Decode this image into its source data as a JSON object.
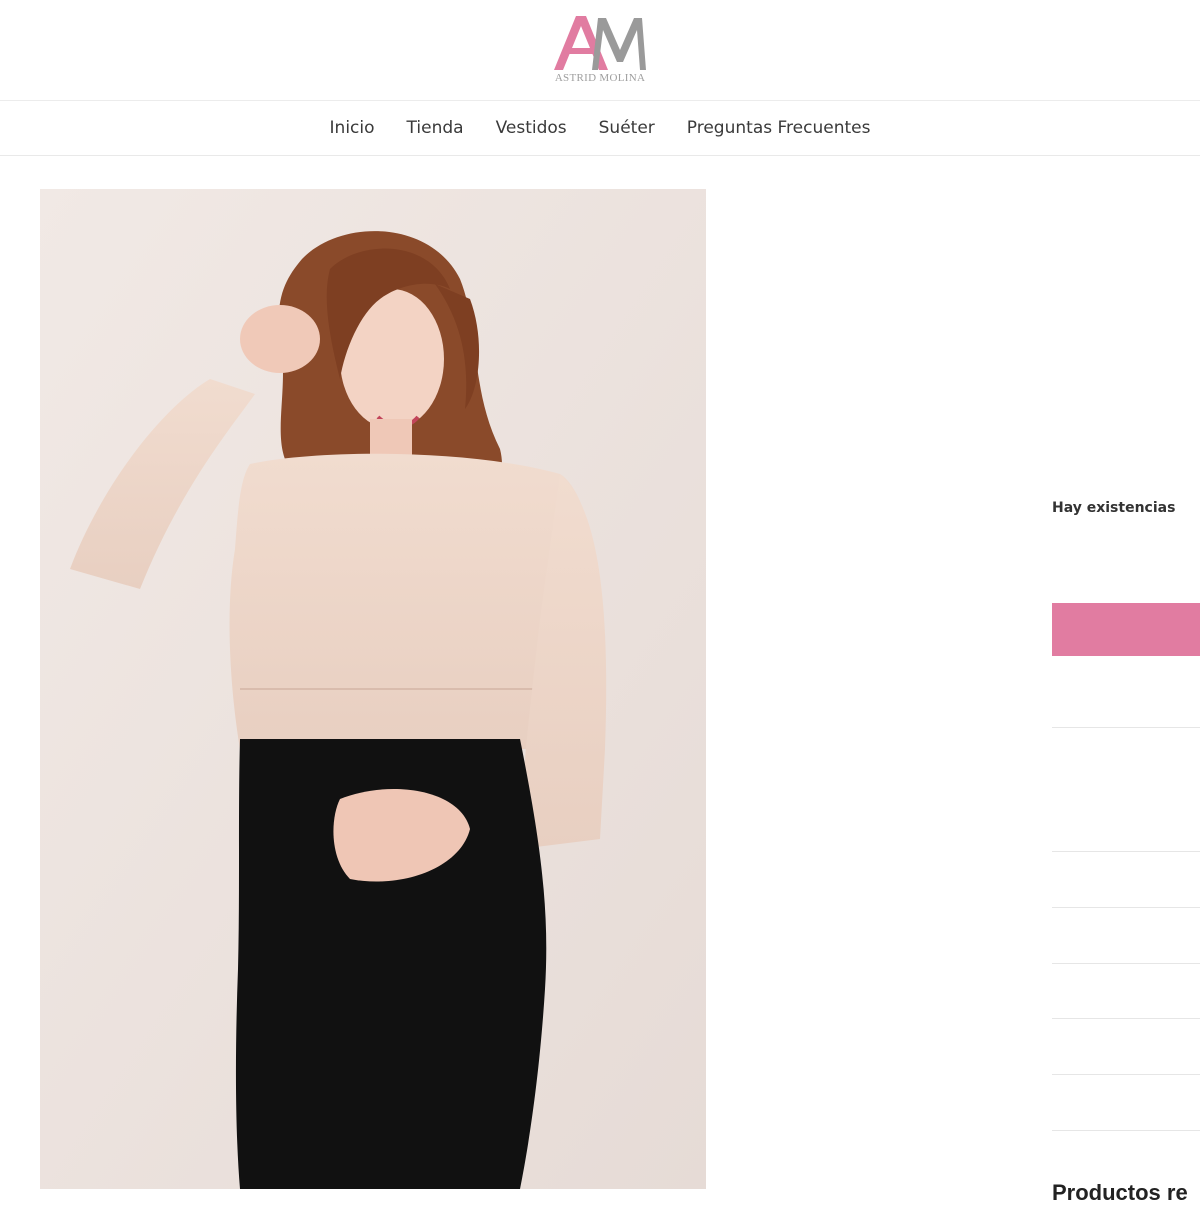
{
  "header": {
    "logo_monogram": "AM",
    "logo_text": "ASTRID MOLINA",
    "accent_color": "#e17ca1"
  },
  "nav": {
    "items": [
      {
        "label": "Inicio"
      },
      {
        "label": "Tienda"
      },
      {
        "label": "Vestidos"
      },
      {
        "label": "Suéter"
      },
      {
        "label": "Preguntas Frecuentes"
      }
    ]
  },
  "product": {
    "image_icon": "product-photo",
    "stock_status": "Hay existencias",
    "add_to_cart_color": "#e17ca1"
  },
  "related": {
    "title": "Productos re"
  }
}
